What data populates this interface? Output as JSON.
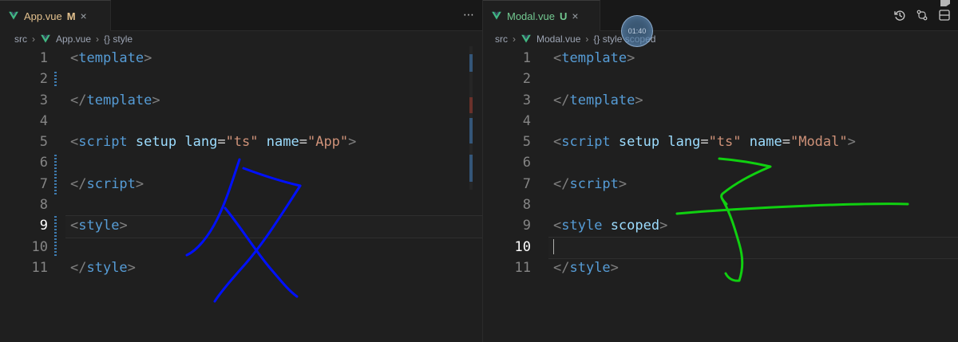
{
  "left": {
    "tab": {
      "file": "App.vue",
      "status": "M"
    },
    "breadcrumb": {
      "root": "src",
      "file": "App.vue",
      "symbol": "{} style"
    },
    "lines": [
      {
        "no": "1",
        "tokens": [
          {
            "t": "bracket",
            "v": "<"
          },
          {
            "t": "tag",
            "v": "template"
          },
          {
            "t": "bracket",
            "v": ">"
          }
        ]
      },
      {
        "no": "2",
        "tokens": []
      },
      {
        "no": "3",
        "tokens": [
          {
            "t": "bracket",
            "v": "</"
          },
          {
            "t": "tag",
            "v": "template"
          },
          {
            "t": "bracket",
            "v": ">"
          }
        ]
      },
      {
        "no": "4",
        "tokens": []
      },
      {
        "no": "5",
        "tokens": [
          {
            "t": "bracket",
            "v": "<"
          },
          {
            "t": "tag",
            "v": "script"
          },
          {
            "t": "plain",
            "v": " "
          },
          {
            "t": "attr",
            "v": "setup"
          },
          {
            "t": "plain",
            "v": " "
          },
          {
            "t": "attr",
            "v": "lang"
          },
          {
            "t": "eq",
            "v": "="
          },
          {
            "t": "str",
            "v": "\"ts\""
          },
          {
            "t": "plain",
            "v": " "
          },
          {
            "t": "attr",
            "v": "name"
          },
          {
            "t": "eq",
            "v": "="
          },
          {
            "t": "str",
            "v": "\"App\""
          },
          {
            "t": "bracket",
            "v": ">"
          }
        ]
      },
      {
        "no": "6",
        "tokens": []
      },
      {
        "no": "7",
        "tokens": [
          {
            "t": "bracket",
            "v": "</"
          },
          {
            "t": "tag",
            "v": "script"
          },
          {
            "t": "bracket",
            "v": ">"
          }
        ]
      },
      {
        "no": "8",
        "tokens": []
      },
      {
        "no": "9",
        "tokens": [
          {
            "t": "bracket",
            "v": "<"
          },
          {
            "t": "tag",
            "v": "style"
          },
          {
            "t": "bracket",
            "v": ">"
          }
        ],
        "active": true
      },
      {
        "no": "10",
        "tokens": []
      },
      {
        "no": "11",
        "tokens": [
          {
            "t": "bracket",
            "v": "</"
          },
          {
            "t": "tag",
            "v": "style"
          },
          {
            "t": "bracket",
            "v": ">"
          }
        ]
      }
    ]
  },
  "right": {
    "tab": {
      "file": "Modal.vue",
      "status": "U"
    },
    "breadcrumb": {
      "root": "src",
      "file": "Modal.vue",
      "symbol": "{} style scoped"
    },
    "lines": [
      {
        "no": "1",
        "tokens": [
          {
            "t": "bracket",
            "v": "<"
          },
          {
            "t": "tag",
            "v": "template"
          },
          {
            "t": "bracket",
            "v": ">"
          }
        ]
      },
      {
        "no": "2",
        "tokens": []
      },
      {
        "no": "3",
        "tokens": [
          {
            "t": "bracket",
            "v": "</"
          },
          {
            "t": "tag",
            "v": "template"
          },
          {
            "t": "bracket",
            "v": ">"
          }
        ]
      },
      {
        "no": "4",
        "tokens": []
      },
      {
        "no": "5",
        "tokens": [
          {
            "t": "bracket",
            "v": "<"
          },
          {
            "t": "tag",
            "v": "script"
          },
          {
            "t": "plain",
            "v": " "
          },
          {
            "t": "attr",
            "v": "setup"
          },
          {
            "t": "plain",
            "v": " "
          },
          {
            "t": "attr",
            "v": "lang"
          },
          {
            "t": "eq",
            "v": "="
          },
          {
            "t": "str",
            "v": "\"ts\""
          },
          {
            "t": "plain",
            "v": " "
          },
          {
            "t": "attr",
            "v": "name"
          },
          {
            "t": "eq",
            "v": "="
          },
          {
            "t": "str",
            "v": "\"Modal\""
          },
          {
            "t": "bracket",
            "v": ">"
          }
        ]
      },
      {
        "no": "6",
        "tokens": []
      },
      {
        "no": "7",
        "tokens": [
          {
            "t": "bracket",
            "v": "</"
          },
          {
            "t": "tag",
            "v": "script"
          },
          {
            "t": "bracket",
            "v": ">"
          }
        ]
      },
      {
        "no": "8",
        "tokens": []
      },
      {
        "no": "9",
        "tokens": [
          {
            "t": "bracket",
            "v": "<"
          },
          {
            "t": "tag",
            "v": "style"
          },
          {
            "t": "plain",
            "v": " "
          },
          {
            "t": "attr",
            "v": "scoped"
          },
          {
            "t": "bracket",
            "v": ">"
          }
        ]
      },
      {
        "no": "10",
        "tokens": [],
        "active": true
      },
      {
        "no": "11",
        "tokens": [
          {
            "t": "bracket",
            "v": "</"
          },
          {
            "t": "tag",
            "v": "style"
          },
          {
            "t": "bracket",
            "v": ">"
          }
        ]
      }
    ]
  },
  "overlay": {
    "recording_time": "01:40",
    "annotation_colors": {
      "left": "#0010ff",
      "right": "#10d010"
    }
  },
  "icons": {
    "vue": "vue-icon",
    "more": "more-actions-icon",
    "close": "close-icon",
    "timeline": "timeline-icon",
    "compare": "compare-changes-icon",
    "split": "split-editor-icon"
  }
}
